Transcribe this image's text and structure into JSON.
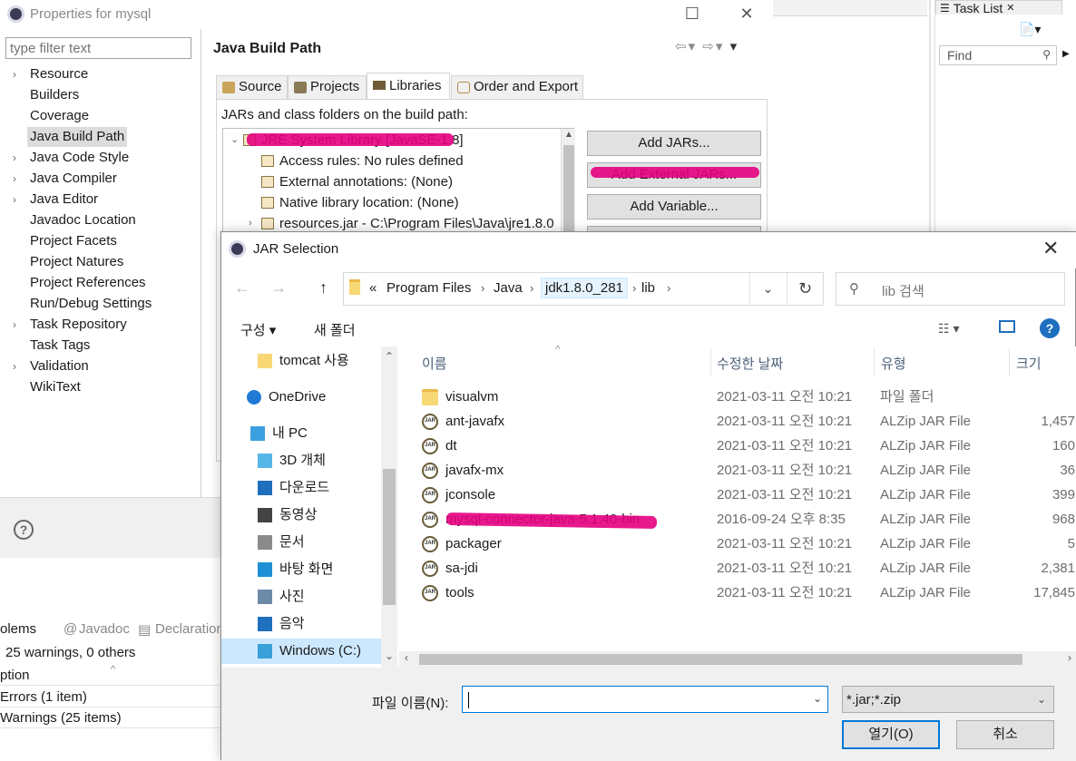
{
  "colors": {
    "accent": "#0078d7",
    "highlight_mark": "#e4007f",
    "selected_bg": "#cce8ff"
  },
  "eclipse": {
    "task_list_tab": "Task List",
    "find_placeholder": "Find"
  },
  "properties": {
    "title": "Properties for mysql",
    "filter_placeholder": "type filter text",
    "tree": [
      {
        "label": "Resource",
        "arrow": ">"
      },
      {
        "label": "Builders",
        "arrow": ""
      },
      {
        "label": "Coverage",
        "arrow": ""
      },
      {
        "label": "Java Build Path",
        "arrow": "",
        "selected": true
      },
      {
        "label": "Java Code Style",
        "arrow": ">"
      },
      {
        "label": "Java Compiler",
        "arrow": ">"
      },
      {
        "label": "Java Editor",
        "arrow": ">"
      },
      {
        "label": "Javadoc Location",
        "arrow": ""
      },
      {
        "label": "Project Facets",
        "arrow": ""
      },
      {
        "label": "Project Natures",
        "arrow": ""
      },
      {
        "label": "Project References",
        "arrow": ""
      },
      {
        "label": "Run/Debug Settings",
        "arrow": ""
      },
      {
        "label": "Task Repository",
        "arrow": ">"
      },
      {
        "label": "Task Tags",
        "arrow": ""
      },
      {
        "label": "Validation",
        "arrow": ">"
      },
      {
        "label": "WikiText",
        "arrow": ""
      }
    ],
    "page_title": "Java Build Path",
    "tabs": [
      "Source",
      "Projects",
      "Libraries",
      "Order and Export"
    ],
    "jars_label": "JARs and class folders on the build path:",
    "build_tree": [
      {
        "label": "JRE System Library [JavaSE-1.8]",
        "arrow": "v"
      },
      {
        "label": "Access rules: No rules defined",
        "arrow": ""
      },
      {
        "label": "External annotations: (None)",
        "arrow": ""
      },
      {
        "label": "Native library location: (None)",
        "arrow": ""
      },
      {
        "label": "resources.jar - C:\\Program Files\\Java\\jre1.8.0",
        "arrow": ">"
      }
    ],
    "buttons": [
      "Add JARs...",
      "Add External JARs...",
      "Add Variable..."
    ]
  },
  "problems": {
    "tabs": [
      "olems",
      "Javadoc",
      "Declaration"
    ],
    "summary": "25 warnings, 0 others",
    "column": "ption",
    "rows": [
      "Errors (1 item)",
      "Warnings (25 items)"
    ]
  },
  "jar_dialog": {
    "title": "JAR Selection",
    "breadcrumb": {
      "overflow": "«",
      "items": [
        "Program Files",
        "Java",
        "jdk1.8.0_281",
        "lib"
      ]
    },
    "search_placeholder": "lib 검색",
    "organize_label": "구성 ▾",
    "new_folder_label": "새 폴더",
    "nav_items": [
      {
        "label": "tomcat 사용",
        "icon": "folder-icon"
      },
      {
        "label": "OneDrive",
        "icon": "cloud-icon"
      },
      {
        "label": "내 PC",
        "icon": "computer-icon"
      },
      {
        "label": "3D 개체",
        "icon": "cube-icon"
      },
      {
        "label": "다운로드",
        "icon": "download-icon"
      },
      {
        "label": "동영상",
        "icon": "video-icon"
      },
      {
        "label": "문서",
        "icon": "document-icon"
      },
      {
        "label": "바탕 화면",
        "icon": "desktop-icon"
      },
      {
        "label": "사진",
        "icon": "picture-icon"
      },
      {
        "label": "음악",
        "icon": "music-icon"
      },
      {
        "label": "Windows (C:)",
        "icon": "drive-icon",
        "selected": true
      }
    ],
    "columns": [
      "이름",
      "수정한 날짜",
      "유형",
      "크기"
    ],
    "files": [
      {
        "name": "visualvm",
        "date": "2021-03-11 오전 10:21",
        "type": "파일 폴더",
        "size": "",
        "kind": "folder"
      },
      {
        "name": "ant-javafx",
        "date": "2021-03-11 오전 10:21",
        "type": "ALZip JAR File",
        "size": "1,457",
        "kind": "jar"
      },
      {
        "name": "dt",
        "date": "2021-03-11 오전 10:21",
        "type": "ALZip JAR File",
        "size": "160",
        "kind": "jar"
      },
      {
        "name": "javafx-mx",
        "date": "2021-03-11 오전 10:21",
        "type": "ALZip JAR File",
        "size": "36",
        "kind": "jar"
      },
      {
        "name": "jconsole",
        "date": "2021-03-11 오전 10:21",
        "type": "ALZip JAR File",
        "size": "399",
        "kind": "jar"
      },
      {
        "name": "mysql-connector-java-5.1.40-bin",
        "date": "2016-09-24 오후 8:35",
        "type": "ALZip JAR File",
        "size": "968",
        "kind": "jar"
      },
      {
        "name": "packager",
        "date": "2021-03-11 오전 10:21",
        "type": "ALZip JAR File",
        "size": "5",
        "kind": "jar"
      },
      {
        "name": "sa-jdi",
        "date": "2021-03-11 오전 10:21",
        "type": "ALZip JAR File",
        "size": "2,381",
        "kind": "jar"
      },
      {
        "name": "tools",
        "date": "2021-03-11 오전 10:21",
        "type": "ALZip JAR File",
        "size": "17,845",
        "kind": "jar"
      }
    ],
    "filename_label": "파일 이름(N):",
    "filename_value": "",
    "filetype_value": "*.jar;*.zip",
    "open_label": "열기(O)",
    "cancel_label": "취소"
  }
}
